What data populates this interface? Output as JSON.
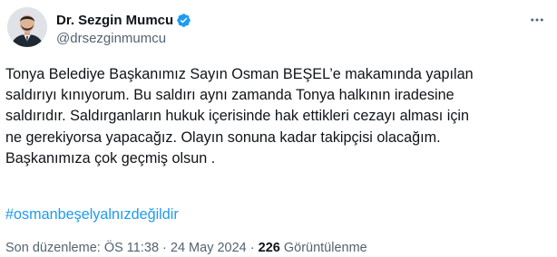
{
  "author": {
    "display_name": "Dr. Sezgin Mumcu",
    "handle": "@drsezginmumcu",
    "verified": true,
    "avatar_icon": "profile-photo",
    "verified_icon": "verified-badge-icon",
    "more_icon": "more-options-icon"
  },
  "tweet": {
    "lines": [
      "Tonya Belediye Başkanımız Sayın Osman BEŞEL’e makamında yapılan",
      "saldırıyı kınıyorum. Bu saldırı aynı zamanda Tonya halkının iradesine",
      "saldırıdır. Saldırganların hukuk içerisinde hak ettikleri cezayı alması için",
      "ne gerekiyorsa yapacağız. Olayın sonuna kadar takipçisi olacağım.",
      "Başkanımıza çok geçmiş olsun ."
    ],
    "hashtag": "#osmanbeşelyalnızdeğildir"
  },
  "meta": {
    "edited_label": "Son düzenleme: ÖS 11:38 · 24 May 2024 · ",
    "views_count": "226",
    "views_label": " Görüntülenme"
  },
  "colors": {
    "text": "#0f1419",
    "secondary": "#536471",
    "link": "#1d9bf0",
    "verified": "#1d9bf0"
  }
}
